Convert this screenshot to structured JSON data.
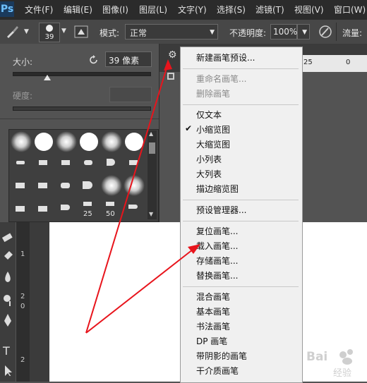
{
  "app": {
    "logo": "Ps"
  },
  "menubar": [
    "文件(F)",
    "编辑(E)",
    "图像(I)",
    "图层(L)",
    "文字(Y)",
    "选择(S)",
    "滤镜(T)",
    "视图(V)",
    "窗口(W)"
  ],
  "options": {
    "brush_size": "39",
    "mode_label": "模式:",
    "mode_value": "正常",
    "opacity_label": "不透明度:",
    "opacity_value": "100%",
    "flow_label": "流量:"
  },
  "brush_panel": {
    "size_label": "大小:",
    "size_value": "39 像素",
    "hardness_label": "硬度:",
    "size_slider_level": 0.25,
    "grid_labels": [
      "25",
      "50"
    ]
  },
  "ruler": {
    "h_marks": [
      "25",
      "0"
    ],
    "v_marks": [
      "1",
      "2",
      "0",
      "2"
    ]
  },
  "context_menu": {
    "items": [
      {
        "label": "新建画笔预设...",
        "disabled": false
      },
      {
        "sep": true
      },
      {
        "label": "重命名画笔...",
        "disabled": true
      },
      {
        "label": "删除画笔",
        "disabled": true
      },
      {
        "sep": true
      },
      {
        "label": "仅文本",
        "disabled": false
      },
      {
        "label": "小缩览图",
        "disabled": false,
        "checked": true
      },
      {
        "label": "大缩览图",
        "disabled": false
      },
      {
        "label": "小列表",
        "disabled": false
      },
      {
        "label": "大列表",
        "disabled": false
      },
      {
        "label": "描边缩览图",
        "disabled": false
      },
      {
        "sep": true
      },
      {
        "label": "预设管理器...",
        "disabled": false
      },
      {
        "sep": true
      },
      {
        "label": "复位画笔...",
        "disabled": false
      },
      {
        "label": "载入画笔...",
        "disabled": false
      },
      {
        "label": "存储画笔...",
        "disabled": false
      },
      {
        "label": "替换画笔...",
        "disabled": false
      },
      {
        "sep": true
      },
      {
        "label": "混合画笔",
        "disabled": false
      },
      {
        "label": "基本画笔",
        "disabled": false
      },
      {
        "label": "书法画笔",
        "disabled": false
      },
      {
        "label": "DP 画笔",
        "disabled": false
      },
      {
        "label": "带阴影的画笔",
        "disabled": false
      },
      {
        "label": "干介质画笔",
        "disabled": false
      }
    ]
  },
  "watermark": {
    "text": "Bai 经验"
  },
  "colors": {
    "annotation_arrow": "#e8141c",
    "menu_bg": "#f0f0f0",
    "panel_bg": "#535353"
  }
}
